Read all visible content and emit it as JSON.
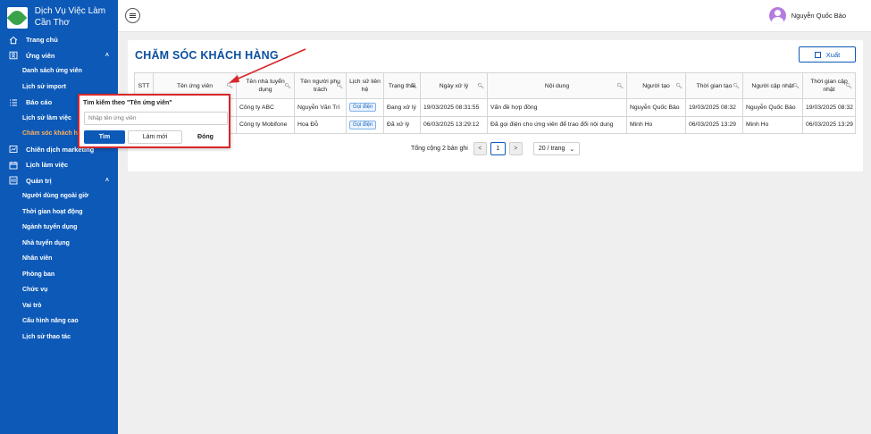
{
  "brand": {
    "title_line1": "Dịch Vụ Việc Làm",
    "title_line2": "Cần Thơ"
  },
  "sidebar": {
    "items": [
      {
        "type": "item",
        "label": "Trang chủ",
        "icon": "home-icon"
      },
      {
        "type": "item",
        "label": "Ứng viên",
        "icon": "user-icon",
        "chevron": "˄"
      },
      {
        "type": "sub",
        "label": "Danh sách ứng viên"
      },
      {
        "type": "sub",
        "label": "Lịch sử import"
      },
      {
        "type": "item",
        "label": "Báo cáo",
        "icon": "list-icon"
      },
      {
        "type": "sub",
        "label": "Lịch sử làm việc"
      },
      {
        "type": "sub",
        "label": "Chăm sóc khách hàng",
        "active": true
      },
      {
        "type": "item",
        "label": "Chiến dịch marketing",
        "icon": "campaign-icon"
      },
      {
        "type": "item",
        "label": "Lịch làm việc",
        "icon": "calendar-icon"
      },
      {
        "type": "item",
        "label": "Quản trị",
        "icon": "admin-icon",
        "chevron": "˄"
      },
      {
        "type": "sub",
        "label": "Người dùng ngoài giờ"
      },
      {
        "type": "sub",
        "label": "Thời gian hoạt động"
      },
      {
        "type": "sub",
        "label": "Ngành tuyển dụng"
      },
      {
        "type": "sub",
        "label": "Nhà tuyển dụng"
      },
      {
        "type": "sub",
        "label": "Nhân viên"
      },
      {
        "type": "sub",
        "label": "Phòng ban"
      },
      {
        "type": "sub",
        "label": "Chức vụ"
      },
      {
        "type": "sub",
        "label": "Vai trò"
      },
      {
        "type": "sub",
        "label": "Cấu hình nâng cao"
      },
      {
        "type": "sub",
        "label": "Lịch sử thao tác"
      }
    ]
  },
  "header": {
    "user_name": "Nguyễn Quốc Bảo"
  },
  "main": {
    "title": "CHĂM SÓC KHÁCH HÀNG",
    "export_label": "Xuất",
    "columns": [
      "STT",
      "Tên ứng viên",
      "Tên nhà tuyển dụng",
      "Tên người phụ trách",
      "Lịch sử liên hệ",
      "Trạng thái",
      "Ngày xử lý",
      "Nội dung",
      "Người tạo",
      "Thời gian tạo",
      "Người cập nhật",
      "Thời gian cập nhật"
    ],
    "rows": [
      [
        "",
        "",
        "Công ty ABC",
        "Nguyễn Văn Trí",
        "Gọi điện",
        "Đang xử lý",
        "19/03/2025 08:31:55",
        "Vấn đề hợp đồng",
        "Nguyễn Quốc Bảo",
        "19/03/2025 08:32",
        "Nguyễn Quốc Bảo",
        "19/03/2025 08:32"
      ],
      [
        "",
        "",
        "Công ty Mobifone",
        "Hoa Đỗ",
        "Gọi điện",
        "Đã xử lý",
        "06/03/2025 13:29:12",
        "Đã gọi điện cho ứng viên để trao đổi nội dung",
        "Minh Ho",
        "06/03/2025 13:29",
        "Minh Ho",
        "06/03/2025 13:29"
      ]
    ],
    "pagination": {
      "total": "Tổng cộng 2 bản ghi",
      "prev": "<",
      "current": "1",
      "next": ">",
      "page_size": "20 / trang"
    }
  },
  "popover": {
    "title": "Tìm kiếm theo \"Tên ứng viên\"",
    "placeholder": "Nhập tên ứng viên",
    "find_label": "Tìm",
    "reset_label": "Làm mới",
    "close_label": "Đóng"
  },
  "colors": {
    "sidebar": "#0c59b8",
    "accent": "#0c59b8",
    "active_sub": "#ffb05a",
    "highlight": "#d8262a"
  }
}
